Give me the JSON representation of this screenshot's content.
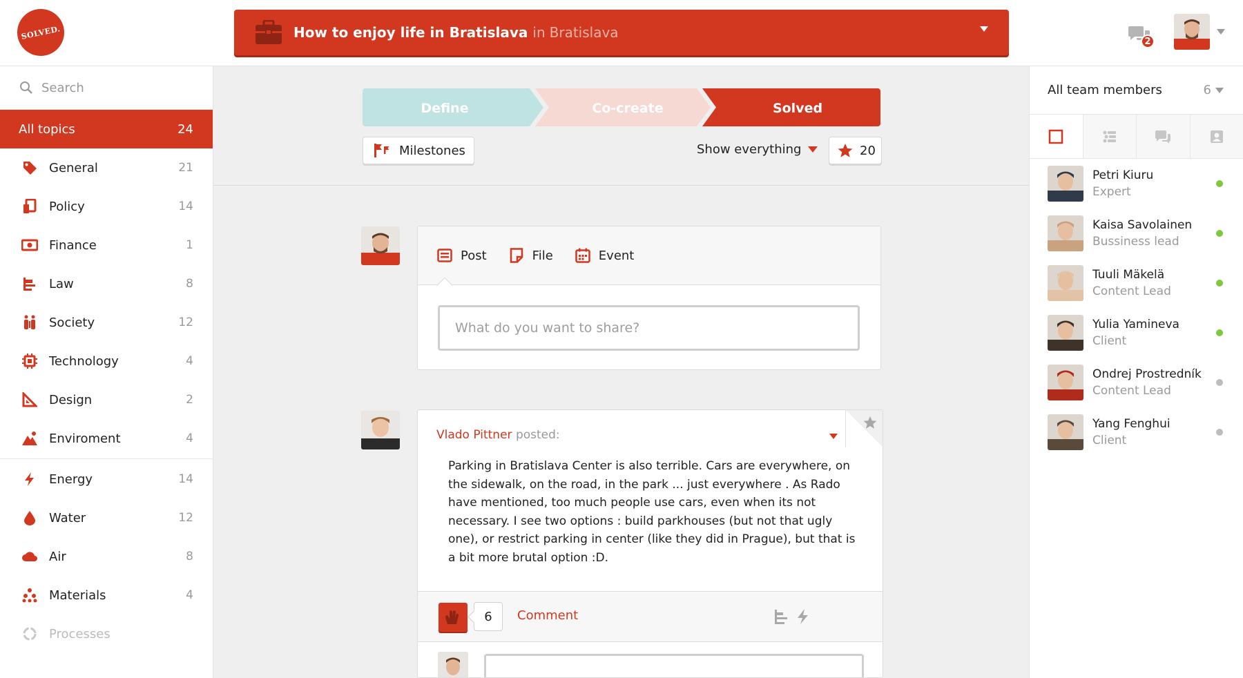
{
  "header": {
    "logo_text": "SOLVED.",
    "topic_title": "How to enjoy life in Bratislava",
    "topic_location_prefix": "in",
    "topic_location": "Bratislava",
    "chat_count": "2"
  },
  "sidebar": {
    "search_placeholder": "Search",
    "all_topics": {
      "label": "All topics",
      "count": "24"
    },
    "categories": [
      {
        "label": "General",
        "count": "21",
        "icon": "tag-icon"
      },
      {
        "label": "Policy",
        "count": "14",
        "icon": "document-icon"
      },
      {
        "label": "Finance",
        "count": "1",
        "icon": "money-icon"
      },
      {
        "label": "Law",
        "count": "8",
        "icon": "gavel-icon"
      },
      {
        "label": "Society",
        "count": "12",
        "icon": "people-icon"
      },
      {
        "label": "Technology",
        "count": "4",
        "icon": "chip-icon"
      },
      {
        "label": "Design",
        "count": "2",
        "icon": "ruler-triangle-icon"
      },
      {
        "label": "Enviroment",
        "count": "4",
        "icon": "mountain-icon"
      }
    ],
    "categories2": [
      {
        "label": "Energy",
        "count": "14",
        "icon": "lightning-icon"
      },
      {
        "label": "Water",
        "count": "12",
        "icon": "drop-icon"
      },
      {
        "label": "Air",
        "count": "8",
        "icon": "cloud-icon"
      },
      {
        "label": "Materials",
        "count": "4",
        "icon": "atoms-icon"
      },
      {
        "label": "Processes",
        "count": "",
        "icon": "cycle-icon"
      }
    ]
  },
  "stepper": {
    "steps": [
      "Define",
      "Co-create",
      "Solved"
    ]
  },
  "toolbar": {
    "milestones_label": "Milestones",
    "filter_label": "Show everything",
    "stars_count": "20"
  },
  "composer": {
    "tabs": [
      "Post",
      "File",
      "Event"
    ],
    "placeholder": "What do you want to share?"
  },
  "post": {
    "author": "Vlado Pittner",
    "action": "posted:",
    "body": "Parking in Bratislava Center is also terrible. Cars are everywhere, on the sidewalk, on the road, in the park ... just everywhere . As Rado have mentioned, too much people use cars, even when its not necessary. I see two options : build parkhouses (but not that ugly one), or restrict parking in center (like they did in Prague), but that is a bit more brutal option :D.",
    "likes": "6",
    "comment_label": "Comment"
  },
  "team": {
    "header_label": "All team members",
    "count": "6",
    "members": [
      {
        "name": "Petri Kiuru",
        "role": "Expert",
        "online": true,
        "color": "#2f3a4a"
      },
      {
        "name": "Kaisa Savolainen",
        "role": "Bussiness lead",
        "online": true,
        "color": "#c9a27f"
      },
      {
        "name": "Tuuli Mäkelä",
        "role": "Content Lead",
        "online": true,
        "color": "#e3c3a6"
      },
      {
        "name": "Yulia Yamineva",
        "role": "Client",
        "online": true,
        "color": "#3e3328"
      },
      {
        "name": "Ondrej Prostredník",
        "role": "Content Lead",
        "online": false,
        "color": "#b12b1d"
      },
      {
        "name": "Yang Fenghui",
        "role": "Client",
        "online": false,
        "color": "#5a4a3c"
      }
    ]
  },
  "colors": {
    "accent": "#d2371f",
    "online": "#7cc93c",
    "offline": "#bdbdbd",
    "define": "#bfe3e3",
    "cocreate": "#f6d9d2"
  }
}
